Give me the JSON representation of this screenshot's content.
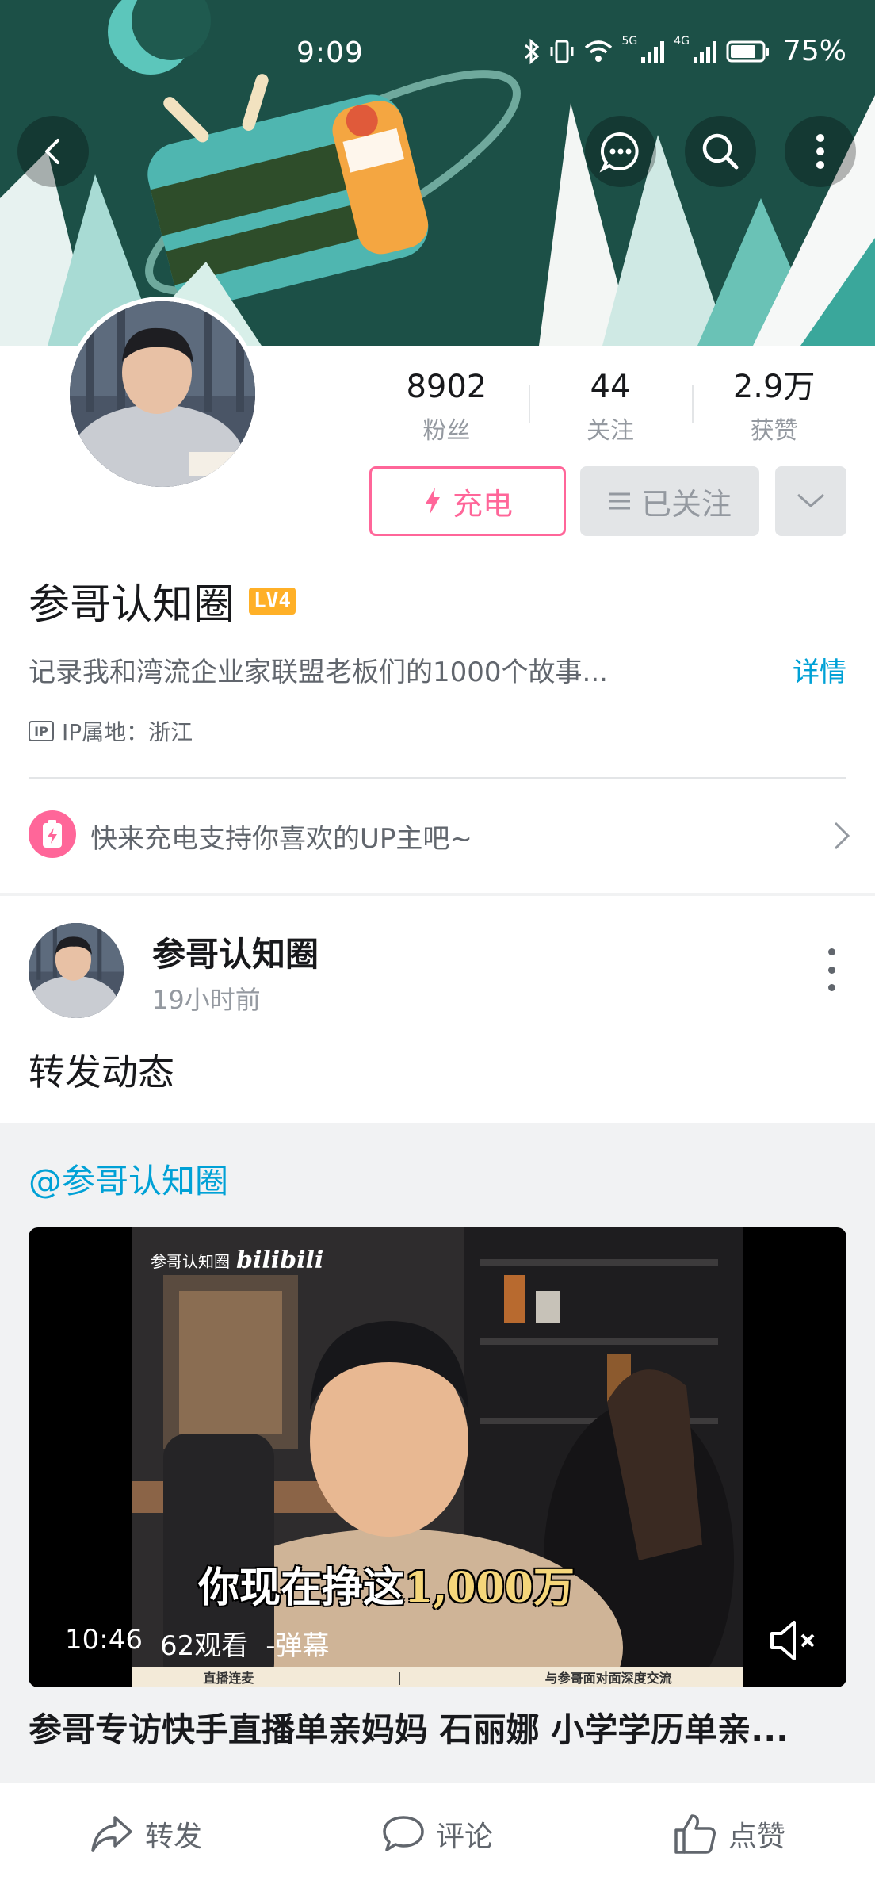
{
  "status_bar": {
    "time": "9:09",
    "network_5g": "5G",
    "network_4g": "4G",
    "battery": "75%"
  },
  "stats": [
    {
      "value": "8902",
      "label": "粉丝"
    },
    {
      "value": "44",
      "label": "关注"
    },
    {
      "value": "2.9万",
      "label": "获赞"
    }
  ],
  "buttons": {
    "charge": "充电",
    "followed": "已关注"
  },
  "profile": {
    "name": "参哥认知圈",
    "level": "LV4",
    "bio": "记录我和湾流企业家联盟老板们的1000个故事...",
    "bio_more": "详情",
    "ip_badge": "IP",
    "ip_location": "IP属地：浙江"
  },
  "charge_banner": {
    "text": "快来充电支持你喜欢的UP主吧~"
  },
  "post": {
    "author": "参哥认知圈",
    "time": "19小时前",
    "text": "转发动态",
    "repost": {
      "mention": "@参哥认知圈",
      "video": {
        "watermark_name": "参哥认知圈",
        "watermark_logo": "bilibili",
        "subtitle_prefix": "你现在挣这",
        "subtitle_highlight": "1,000万",
        "strip_left": "直播连麦",
        "strip_right": "与参哥面对面深度交流",
        "duration": "10:46",
        "views": "62观看",
        "danmaku": "-弹幕"
      },
      "title": "参哥专访快手直播单亲妈妈 石丽娜 小学学历单亲..."
    }
  },
  "actions": {
    "share": "转发",
    "comment": "评论",
    "like": "点赞"
  },
  "colors": {
    "pink": "#ff6699",
    "blue_link": "#00a1d6",
    "level_badge": "#ffb027"
  }
}
